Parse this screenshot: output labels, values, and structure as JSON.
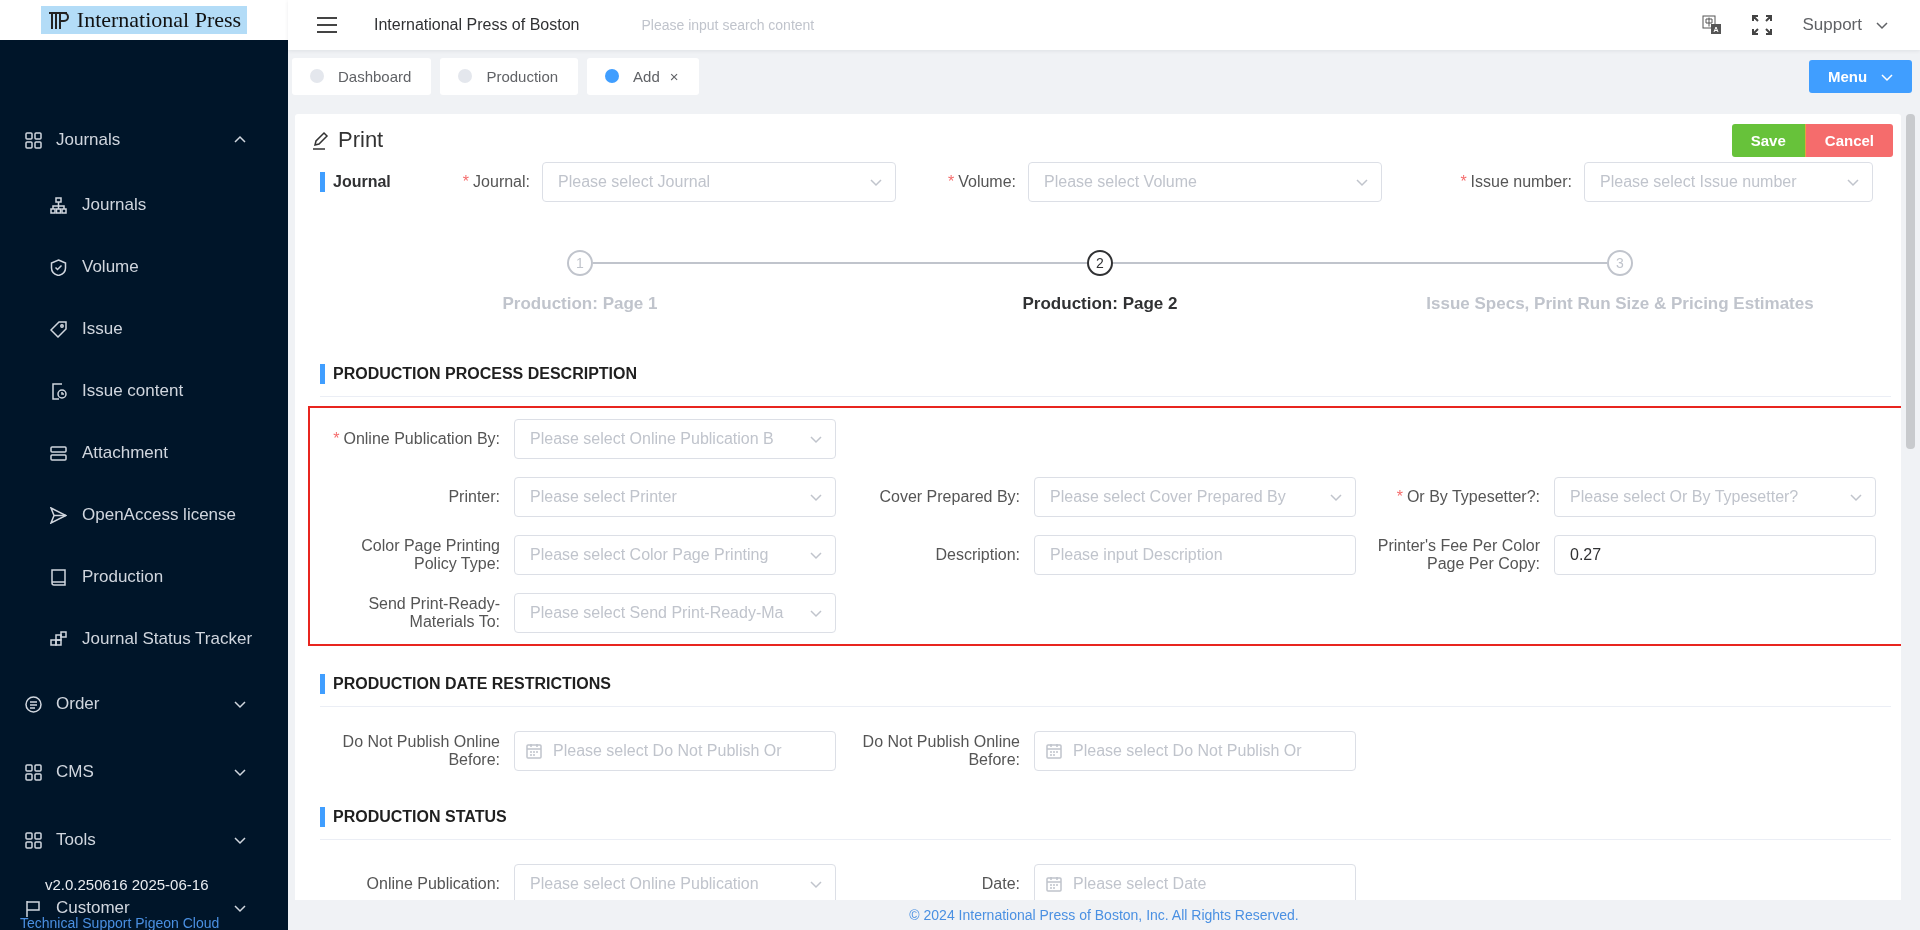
{
  "sidebar": {
    "logo": "International Press",
    "menu": [
      {
        "label": "Journals",
        "expanded": true,
        "children": [
          {
            "label": "Journals"
          },
          {
            "label": "Volume"
          },
          {
            "label": "Issue"
          },
          {
            "label": "Issue content"
          },
          {
            "label": "Attachment"
          },
          {
            "label": "OpenAccess license"
          },
          {
            "label": "Production"
          },
          {
            "label": "Journal Status Tracker"
          }
        ]
      },
      {
        "label": "Order",
        "expanded": false
      },
      {
        "label": "CMS",
        "expanded": false
      },
      {
        "label": "Tools",
        "expanded": false
      },
      {
        "label": "Customer",
        "expanded": false
      }
    ],
    "version": "v2.0.250616 2025-06-16",
    "support_link": "Technical Support Pigeon Cloud"
  },
  "header": {
    "title": "International Press of Boston",
    "search": {
      "placeholder": "Please input search content"
    },
    "user_menu": "Support"
  },
  "tabs": [
    {
      "label": "Dashboard",
      "selected": false
    },
    {
      "label": "Production",
      "selected": false
    },
    {
      "label": "Add",
      "selected": true,
      "close": "×"
    }
  ],
  "menu_button": "Menu",
  "page": {
    "title": "Print",
    "buttons": [
      {
        "label": "Save",
        "kind": "success"
      },
      {
        "label": "Cancel",
        "kind": "danger"
      }
    ],
    "journal": {
      "heading": "Journal",
      "fields": [
        {
          "label": "Journal:",
          "required_mark": "*",
          "kind": "select",
          "placeholder": "Please select Journal"
        },
        {
          "label": "Volume:",
          "required_mark": "*",
          "kind": "select",
          "placeholder": "Please select Volume"
        },
        {
          "label": "Issue number:",
          "required_mark": "*",
          "kind": "select",
          "placeholder": "Please select Issue number"
        }
      ]
    },
    "steps": [
      {
        "number": "1",
        "label": "Production: Page 1",
        "active": false
      },
      {
        "number": "2",
        "label": "Production: Page 2",
        "active": true
      },
      {
        "number": "3",
        "label": "Issue Specs, Print Run Size & Pricing Estimates",
        "active": false
      }
    ],
    "sections": [
      {
        "title": "PRODUCTION PROCESS DESCRIPTION",
        "highlighted": true,
        "rows": [
          [
            {
              "label": "Online Publication By:",
              "required_mark": "*",
              "kind": "select",
              "placeholder": "Please select Online Publication B"
            }
          ],
          [
            {
              "label": "Printer:",
              "kind": "select",
              "placeholder": "Please select Printer"
            },
            {
              "label": "Cover Prepared By:",
              "kind": "select",
              "placeholder": "Please select Cover Prepared By"
            },
            {
              "label": "Or By Typesetter?:",
              "required_mark": "*",
              "kind": "select",
              "placeholder": "Please select Or By Typesetter?"
            }
          ],
          [
            {
              "label": "Color Page Printing Policy Type:",
              "kind": "select",
              "placeholder": "Please select Color Page Printing"
            },
            {
              "label": "Description:",
              "kind": "input",
              "placeholder": "Please input Description"
            },
            {
              "label": "Printer's Fee Per Color Page Per Copy:",
              "kind": "input",
              "value": "0.27"
            }
          ],
          [
            {
              "label": "Send Print-Ready-Materials To:",
              "kind": "select",
              "placeholder": "Please select Send Print-Ready-Ma"
            }
          ]
        ]
      },
      {
        "title": "PRODUCTION DATE RESTRICTIONS",
        "highlighted": false,
        "rows": [
          [
            {
              "label": "Do Not Publish Online Before:",
              "kind": "date",
              "placeholder": "Please select Do Not Publish Or"
            },
            {
              "label": "Do Not Publish Online Before:",
              "kind": "date",
              "placeholder": "Please select Do Not Publish Or"
            }
          ]
        ]
      },
      {
        "title": "PRODUCTION STATUS",
        "highlighted": false,
        "rows": [
          [
            {
              "label": "Online Publication:",
              "kind": "select",
              "placeholder": "Please select Online Publication"
            },
            {
              "label": "Date:",
              "kind": "date",
              "placeholder": "Please select Date"
            }
          ]
        ]
      }
    ]
  },
  "footer": "© 2024 International Press of Boston, Inc. All Rights Reserved."
}
